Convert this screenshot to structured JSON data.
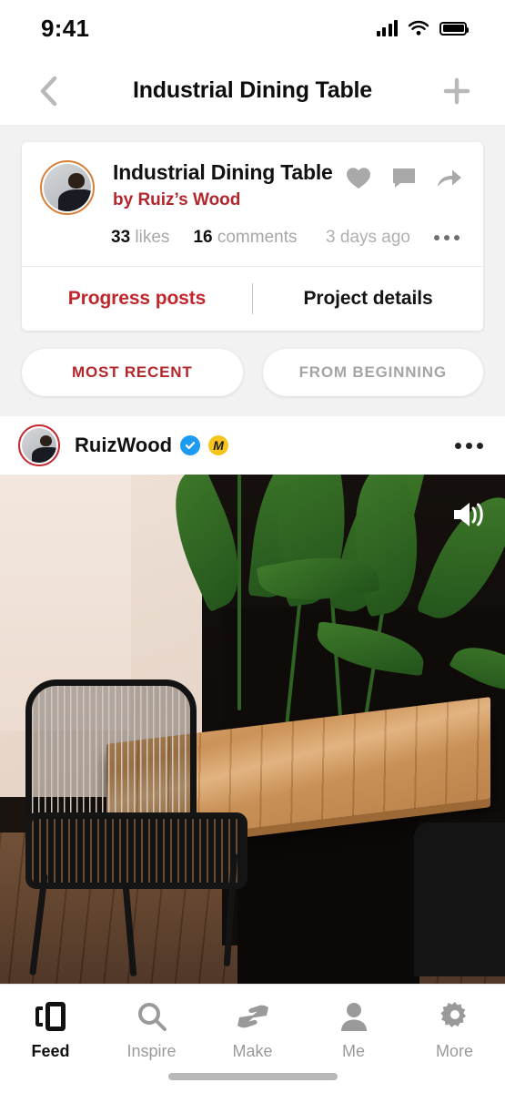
{
  "status_bar": {
    "time": "9:41",
    "signal_icon": "signal-bars-icon",
    "wifi_icon": "wifi-icon",
    "battery_icon": "battery-full-icon"
  },
  "nav_bar": {
    "back_icon": "chevron-left-icon",
    "title": "Industrial Dining Table",
    "add_icon": "plus-icon"
  },
  "project_card": {
    "avatar": "user-avatar",
    "title": "Industrial Dining Table",
    "byline": "by Ruiz’s Wood",
    "actions": [
      {
        "name": "like-button",
        "icon": "heart-icon"
      },
      {
        "name": "comment-button",
        "icon": "speech-bubble-icon"
      },
      {
        "name": "share-button",
        "icon": "share-arrow-icon"
      }
    ],
    "likes_count": "33",
    "likes_label": "likes",
    "comments_count": "16",
    "comments_label": "comments",
    "timestamp": "3 days ago",
    "overflow_icon": "more-horizontal-icon",
    "tabs": [
      {
        "label": "Progress posts",
        "active": true
      },
      {
        "label": "Project details",
        "active": false
      }
    ]
  },
  "filter_pills": [
    {
      "label": "MOST RECENT",
      "selected": true
    },
    {
      "label": "FROM BEGINNING",
      "selected": false
    }
  ],
  "post": {
    "avatar": "user-avatar",
    "username": "RuizWood",
    "verified_badge": "verified-check-icon",
    "pro_badge": "M",
    "overflow_icon": "more-horizontal-icon",
    "media": {
      "alt": "industrial reclaimed wood dining table with black base, wire chair and tropical plant",
      "sound_icon": "volume-on-icon"
    }
  },
  "tab_bar": {
    "items": [
      {
        "label": "Feed",
        "icon": "feed-cards-icon",
        "active": true
      },
      {
        "label": "Inspire",
        "icon": "search-icon",
        "active": false
      },
      {
        "label": "Make",
        "icon": "hands-make-icon",
        "active": false
      },
      {
        "label": "Me",
        "icon": "person-icon",
        "active": false
      },
      {
        "label": "More",
        "icon": "gear-icon",
        "active": false
      }
    ]
  },
  "colors": {
    "accent_red": "#b3262c",
    "tab_active_red": "#c0272d",
    "verified_blue": "#1d9bf0",
    "pro_yellow": "#f5c51e",
    "avatar_ring_orange": "#d8803a",
    "avatar_ring_red": "#c32a33"
  },
  "home_indicator": "home-indicator"
}
